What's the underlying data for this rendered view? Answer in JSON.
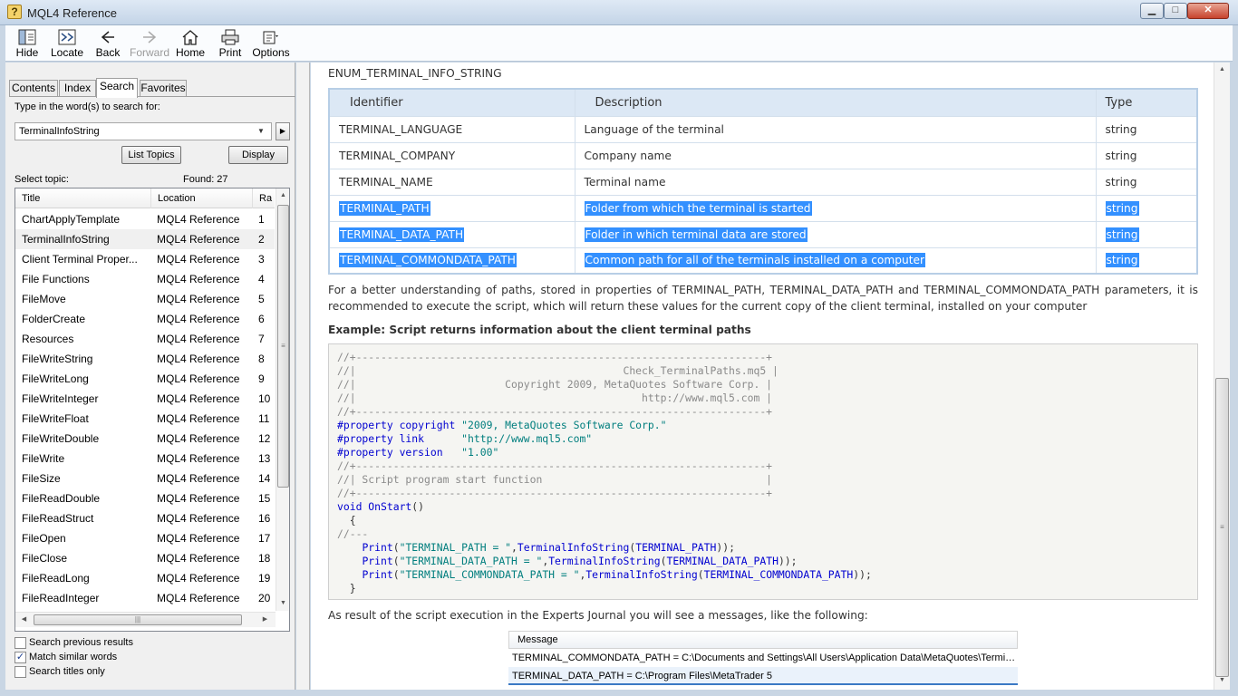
{
  "window": {
    "title": "MQL4 Reference",
    "app_icon": "?",
    "min_glyph": "▁",
    "max_glyph": "□",
    "close_glyph": "✕"
  },
  "toolbar": {
    "hide": "Hide",
    "locate": "Locate",
    "back": "Back",
    "forward": "Forward",
    "home": "Home",
    "print": "Print",
    "options": "Options"
  },
  "tabs": {
    "contents": "Contents",
    "index": "Index",
    "search": "Search",
    "favorites": "Favorites"
  },
  "search": {
    "prompt": "Type in the word(s) to search for:",
    "value": "TerminalInfoString",
    "list_topics": "List Topics",
    "display": "Display",
    "select_topic": "Select topic:",
    "found": "Found: 27"
  },
  "results": {
    "headers": {
      "title": "Title",
      "location": "Location",
      "rank": "Ra"
    },
    "rows": [
      {
        "title": "ChartApplyTemplate",
        "location": "MQL4 Reference",
        "rank": "1"
      },
      {
        "title": "TerminalInfoString",
        "location": "MQL4 Reference",
        "rank": "2"
      },
      {
        "title": "Client Terminal Proper...",
        "location": "MQL4 Reference",
        "rank": "3"
      },
      {
        "title": "File Functions",
        "location": "MQL4 Reference",
        "rank": "4"
      },
      {
        "title": "FileMove",
        "location": "MQL4 Reference",
        "rank": "5"
      },
      {
        "title": "FolderCreate",
        "location": "MQL4 Reference",
        "rank": "6"
      },
      {
        "title": "Resources",
        "location": "MQL4 Reference",
        "rank": "7"
      },
      {
        "title": "FileWriteString",
        "location": "MQL4 Reference",
        "rank": "8"
      },
      {
        "title": "FileWriteLong",
        "location": "MQL4 Reference",
        "rank": "9"
      },
      {
        "title": "FileWriteInteger",
        "location": "MQL4 Reference",
        "rank": "10"
      },
      {
        "title": "FileWriteFloat",
        "location": "MQL4 Reference",
        "rank": "11"
      },
      {
        "title": "FileWriteDouble",
        "location": "MQL4 Reference",
        "rank": "12"
      },
      {
        "title": "FileWrite",
        "location": "MQL4 Reference",
        "rank": "13"
      },
      {
        "title": "FileSize",
        "location": "MQL4 Reference",
        "rank": "14"
      },
      {
        "title": "FileReadDouble",
        "location": "MQL4 Reference",
        "rank": "15"
      },
      {
        "title": "FileReadStruct",
        "location": "MQL4 Reference",
        "rank": "16"
      },
      {
        "title": "FileOpen",
        "location": "MQL4 Reference",
        "rank": "17"
      },
      {
        "title": "FileClose",
        "location": "MQL4 Reference",
        "rank": "18"
      },
      {
        "title": "FileReadLong",
        "location": "MQL4 Reference",
        "rank": "19"
      },
      {
        "title": "FileReadInteger",
        "location": "MQL4 Reference",
        "rank": "20"
      }
    ]
  },
  "options": {
    "previous": {
      "label": "Search previous results",
      "checked": false
    },
    "similar": {
      "label": "Match similar words",
      "checked": true
    },
    "titles": {
      "label": "Search titles only",
      "checked": false
    }
  },
  "content": {
    "enum_title": "ENUM_TERMINAL_INFO_STRING",
    "table_headers": {
      "identifier": "Identifier",
      "description": "Description",
      "type": "Type"
    },
    "table_rows": [
      {
        "id": "TERMINAL_LANGUAGE",
        "desc": "Language of the terminal",
        "type": "string",
        "selected": false
      },
      {
        "id": "TERMINAL_COMPANY",
        "desc": "Company name",
        "type": "string",
        "selected": false
      },
      {
        "id": "TERMINAL_NAME",
        "desc": "Terminal name",
        "type": "string",
        "selected": false
      },
      {
        "id": "TERMINAL_PATH",
        "desc": "Folder from which the terminal is started",
        "type": "string",
        "selected": true
      },
      {
        "id": "TERMINAL_DATA_PATH",
        "desc": "Folder in which terminal data are stored",
        "type": "string",
        "selected": true
      },
      {
        "id": "TERMINAL_COMMONDATA_PATH",
        "desc": "Common path for all of the terminals installed on a computer",
        "type": "string",
        "selected": true
      }
    ],
    "paragraph": "For a better understanding of paths, stored in properties of TERMINAL_PATH, TERMINAL_DATA_PATH and TERMINAL_COMMONDATA_PATH parameters, it is recommended to execute the script, which will return these values for the current copy of the client terminal, installed on your computer",
    "example_title": "Example: Script returns information about the client terminal paths",
    "result_text": "As result of the script execution in the Experts Journal you will see a messages, like the following:"
  },
  "code": {
    "c1": "//+------------------------------------------------------------------+",
    "c2": "//|                                           Check_TerminalPaths.mq5 |",
    "c3": "//|                        Copyright 2009, MetaQuotes Software Corp. |",
    "c4": "//|                                              http://www.mql5.com |",
    "c5": "//+------------------------------------------------------------------+",
    "p1_kw": "#property copyright ",
    "p1_val": "\"2009, MetaQuotes Software Corp.\"",
    "p2_kw": "#property link      ",
    "p2_val": "\"http://www.mql5.com\"",
    "p3_kw": "#property version   ",
    "p3_val": "\"1.00\"",
    "c6": "//+------------------------------------------------------------------+",
    "c7": "//| Script program start function                                    |",
    "c8": "//+------------------------------------------------------------------+",
    "void_kw": "void OnStart",
    "void_paren": "()",
    "brace_open": "  {",
    "c9": "//---",
    "print": "Print",
    "l1_str": "\"TERMINAL_PATH = \"",
    "l1_fn": "TerminalInfoString",
    "l1_arg": "TERMINAL_PATH",
    "l2_str": "\"TERMINAL_DATA_PATH = \"",
    "l2_fn": "TerminalInfoString",
    "l2_arg": "TERMINAL_DATA_PATH",
    "l3_str": "\"TERMINAL_COMMONDATA_PATH = \"",
    "l3_fn": "TerminalInfoString",
    "l3_arg": "TERMINAL_COMMONDATA_PATH",
    "brace_close": "  }"
  },
  "messages": {
    "header": "Message",
    "rows": [
      "TERMINAL_COMMONDATA_PATH = C:\\Documents and Settings\\All Users\\Application Data\\MetaQuotes\\Terminal...",
      "TERMINAL_DATA_PATH = C:\\Program Files\\MetaTrader 5"
    ]
  },
  "colors": {
    "selection": "#3390ff",
    "table_header": "#dce8f5",
    "code_keyword": "#0000d0",
    "code_string": "#007e7e",
    "code_comment": "#8a8a8a"
  }
}
